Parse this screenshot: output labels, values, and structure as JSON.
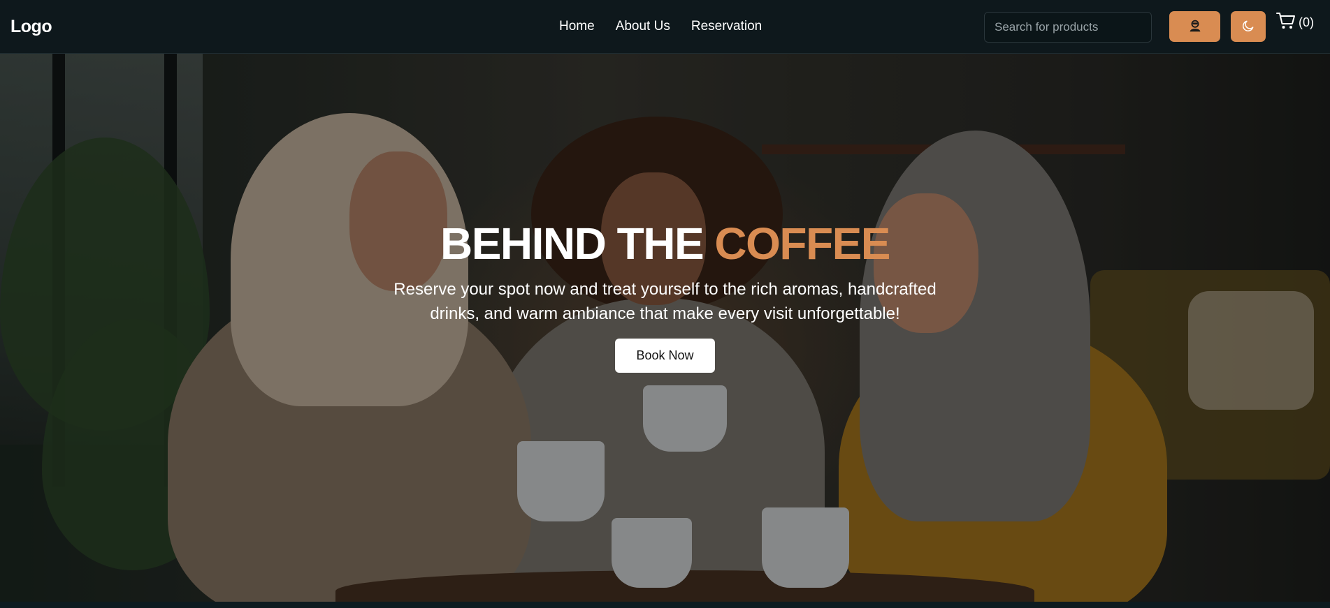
{
  "nav": {
    "logo": "Logo",
    "links": [
      "Home",
      "About Us",
      "Reservation"
    ],
    "search_placeholder": "Search for products",
    "user_icon": "user-icon",
    "theme_icon": "moon-icon",
    "cart_icon": "cart-icon",
    "cart_count": "(0)"
  },
  "hero": {
    "title_main": "BEHIND THE",
    "title_accent": "COFFEE",
    "subtitle": "Reserve your spot now and treat yourself to the rich aromas, handcrafted drinks, and warm ambiance that make every visit unforgettable!",
    "cta_label": "Book Now"
  },
  "colors": {
    "accent": "#d98c52",
    "nav_background": "#0e181c"
  }
}
